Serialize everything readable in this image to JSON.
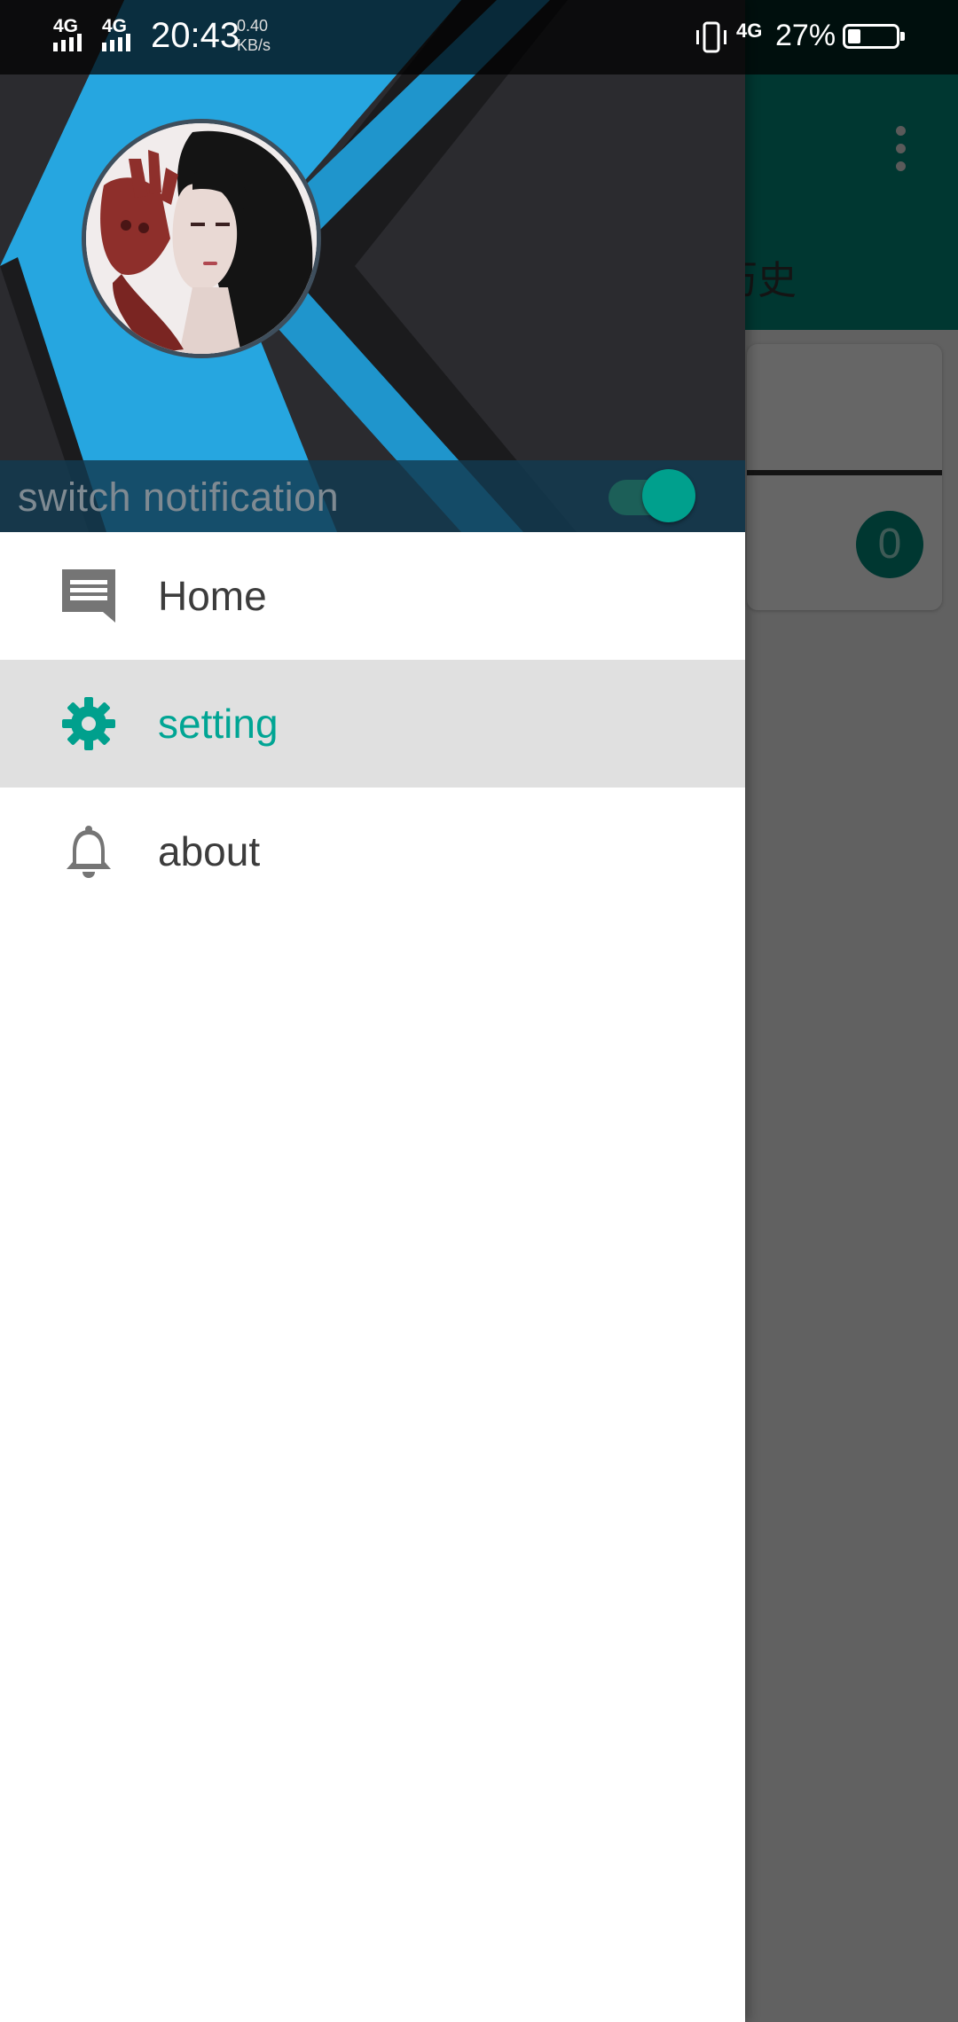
{
  "status_bar": {
    "network_1": "4G",
    "network_2": "4G",
    "time": "20:43",
    "speed_value": "0.40",
    "speed_unit": "KB/s",
    "network_3": "4G",
    "battery_percent": "27%",
    "battery_level": 0.27
  },
  "background_app": {
    "partial_tab_text": "历史",
    "badge_count": "0",
    "toolbar_color": "#00897b"
  },
  "drawer": {
    "header": {
      "notification_label": "switch notification",
      "notification_enabled": true,
      "accent_color": "#26a6e0"
    },
    "menu": [
      {
        "label": "Home",
        "icon": "message-icon",
        "active": false
      },
      {
        "label": "setting",
        "icon": "gear-icon",
        "active": true
      },
      {
        "label": "about",
        "icon": "bell-icon",
        "active": false
      }
    ],
    "active_color": "#00a594"
  }
}
